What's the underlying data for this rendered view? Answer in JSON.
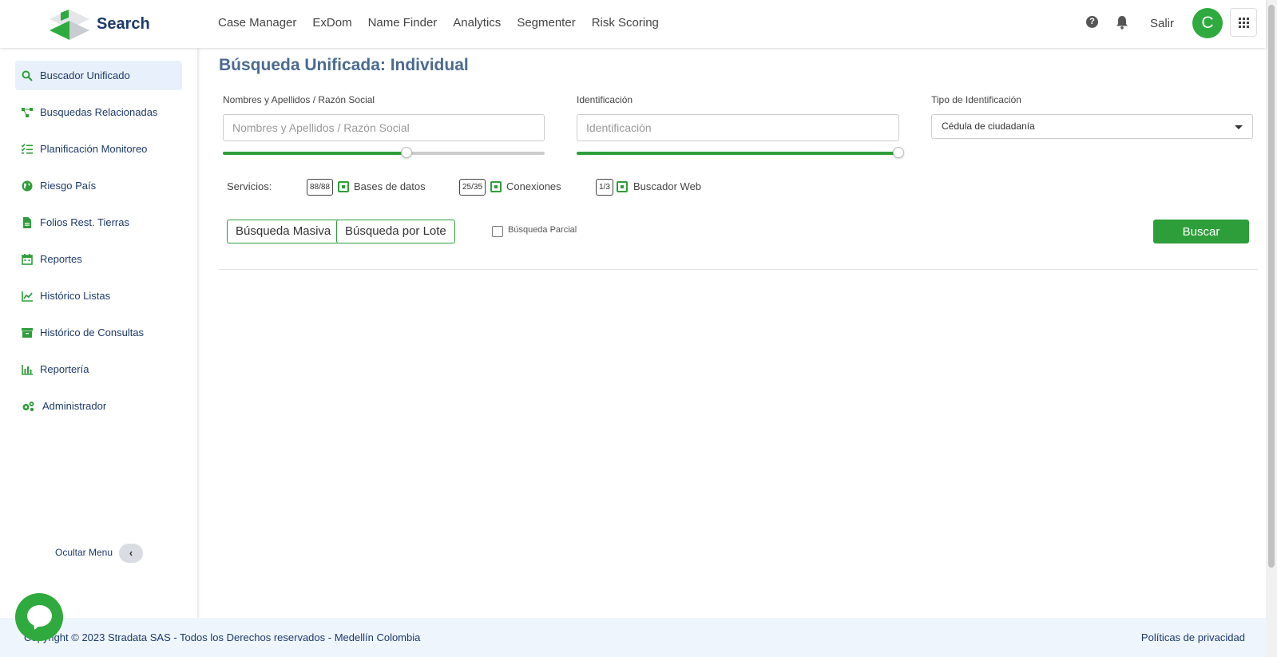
{
  "app": {
    "brand": "Search"
  },
  "topnav": [
    "Case Manager",
    "ExDom",
    "Name Finder",
    "Analytics",
    "Segmenter",
    "Risk Scoring"
  ],
  "header": {
    "salir": "Salir",
    "avatar_initial": "C",
    "help_icon": "question-circle-icon",
    "bell_icon": "bell-icon",
    "apps_icon": "grid-icon"
  },
  "sidebar": {
    "items": [
      {
        "label": "Buscador Unificado",
        "icon": "search-icon",
        "active": true
      },
      {
        "label": "Busquedas Relacionadas",
        "icon": "network-icon"
      },
      {
        "label": "Planificación Monitoreo",
        "icon": "checklist-icon"
      },
      {
        "label": "Riesgo País",
        "icon": "globe-icon"
      },
      {
        "label": "Folios Rest. Tierras",
        "icon": "file-icon"
      },
      {
        "label": "Reportes",
        "icon": "calendar-icon"
      },
      {
        "label": "Histórico Listas",
        "icon": "line-chart-icon"
      },
      {
        "label": "Histórico de Consultas",
        "icon": "archive-icon"
      },
      {
        "label": "Reportería",
        "icon": "bar-chart-icon"
      },
      {
        "label": "Administrador",
        "icon": "gears-icon"
      }
    ],
    "hide_menu": "Ocultar Menu",
    "hide_glyph": "‹"
  },
  "main": {
    "title": "Búsqueda Unificada: Individual",
    "name_label": "Nombres y Apellidos / Razón Social",
    "name_placeholder": "Nombres y Apellidos / Razón Social",
    "name_slider": 0.57,
    "id_label": "Identificación",
    "id_placeholder": "Identificación",
    "id_slider": 1.0,
    "type_label": "Tipo de Identificación",
    "type_value": "Cédula de ciudadanía",
    "services_label": "Servicios:",
    "services": [
      {
        "count": "88/88",
        "label": "Bases de datos"
      },
      {
        "count": "25/35",
        "label": "Conexiones"
      },
      {
        "count": "1/3",
        "label": "Buscador Web"
      }
    ],
    "bulk_button": "Búsqueda Masiva",
    "batch_button": "Búsqueda por Lote",
    "partial_label": "Búsqueda Parcial",
    "search_button": "Buscar"
  },
  "footer": {
    "copyright": "Copyright © 2023 Stradata SAS - Todos los Derechos reservados - Medellín Colombia",
    "privacy": "Políticas de privacidad"
  },
  "colors": {
    "accent": "#2e9e3a",
    "brand": "#1d3a6b",
    "title": "#4a6a91"
  }
}
